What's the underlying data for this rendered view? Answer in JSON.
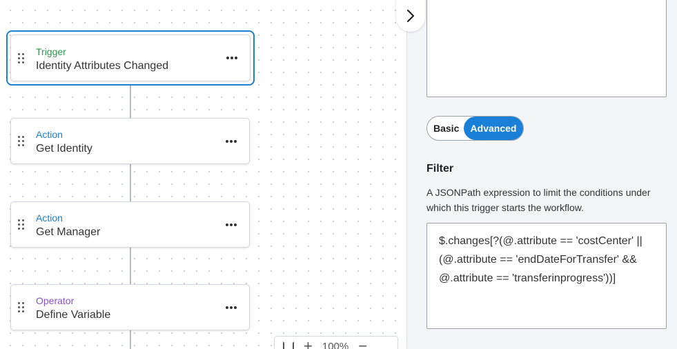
{
  "canvas": {
    "nodes": [
      {
        "type": "Trigger",
        "name": "Identity Attributes Changed"
      },
      {
        "type": "Action",
        "name": "Get Identity"
      },
      {
        "type": "Action",
        "name": "Get Manager"
      },
      {
        "type": "Operator",
        "name": "Define Variable"
      }
    ],
    "zoom": "100%"
  },
  "panel": {
    "mode_basic": "Basic",
    "mode_advanced": "Advanced",
    "filter_title": "Filter",
    "filter_description": "A JSONPath expression to limit the conditions under which this trigger starts the workflow.",
    "filter_value": "$.changes[?(@.attribute == 'costCenter' ||\n(@.attribute == 'endDateForTransfer' &&\n@.attribute == 'transferinprogress'))]"
  }
}
